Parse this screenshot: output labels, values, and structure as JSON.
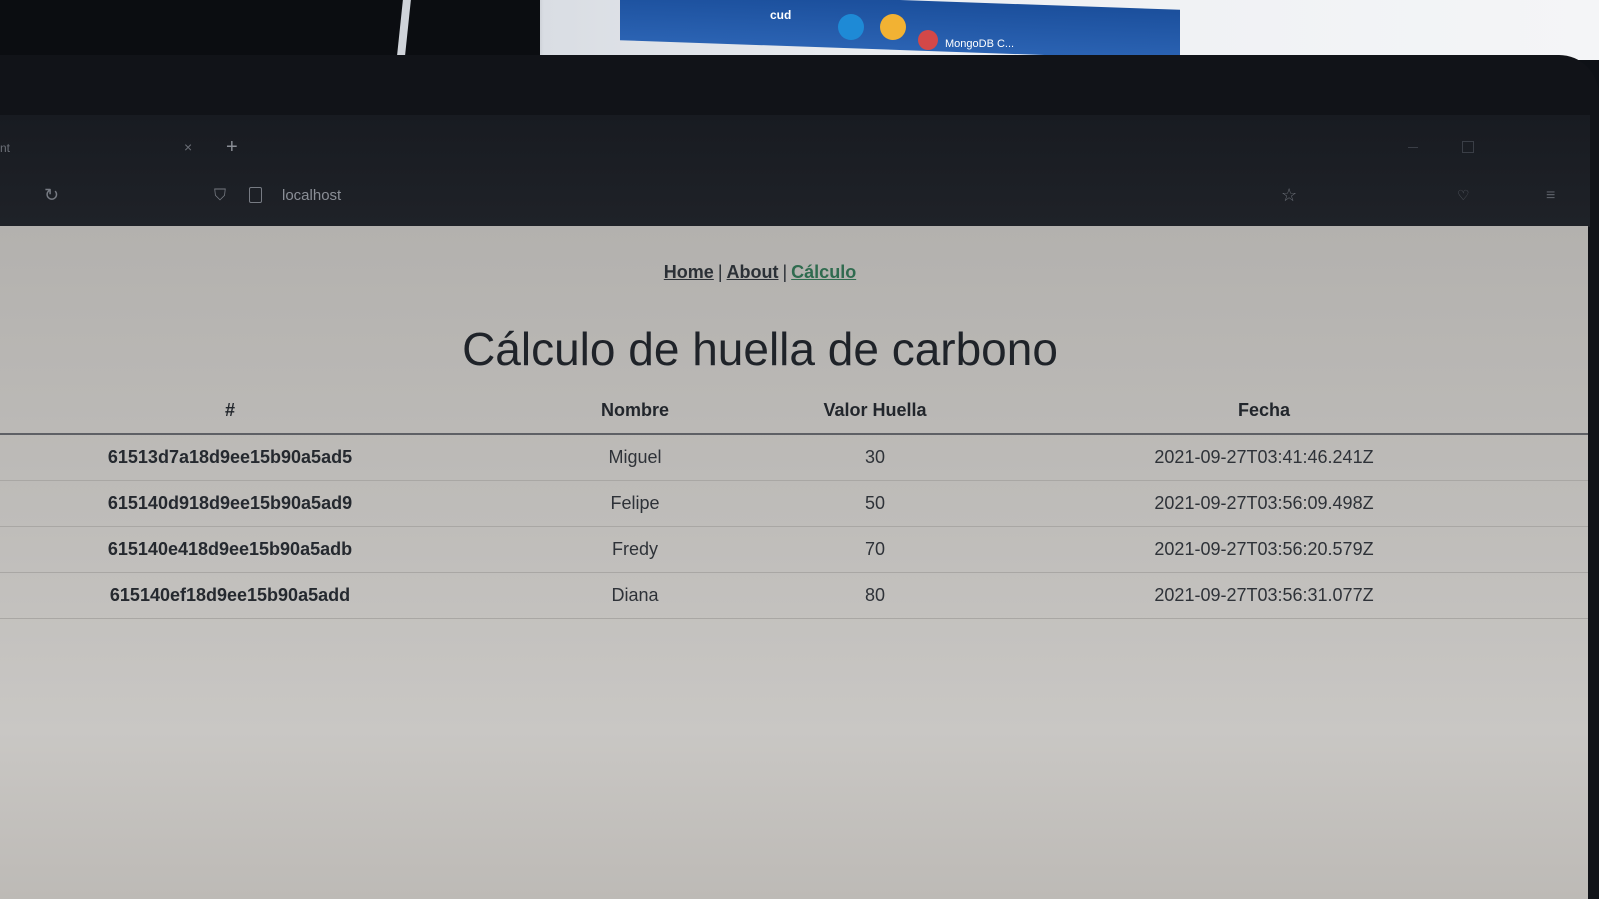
{
  "background": {
    "taskbar_label": "cud",
    "taskbar_app_label": "MongoDB C..."
  },
  "browser": {
    "tab_title_fragment": "nt",
    "tab_close": "×",
    "new_tab": "+",
    "url": "localhost",
    "icons": {
      "reload": "reload-icon",
      "shield": "shield-icon",
      "page": "page-icon",
      "star": "star-icon",
      "pocket": "pocket-icon",
      "menu": "menu-icon"
    }
  },
  "nav": {
    "home": "Home",
    "about": "About",
    "calculo": "Cálculo",
    "separator": "|"
  },
  "page_title": "Cálculo de huella de carbono",
  "table": {
    "headers": [
      "#",
      "Nombre",
      "Valor Huella",
      "Fecha"
    ],
    "rows": [
      {
        "id": "61513d7a18d9ee15b90a5ad5",
        "nombre": "Miguel",
        "valor": "30",
        "fecha": "2021-09-27T03:41:46.241Z"
      },
      {
        "id": "615140d918d9ee15b90a5ad9",
        "nombre": "Felipe",
        "valor": "50",
        "fecha": "2021-09-27T03:56:09.498Z"
      },
      {
        "id": "615140e418d9ee15b90a5adb",
        "nombre": "Fredy",
        "valor": "70",
        "fecha": "2021-09-27T03:56:20.579Z"
      },
      {
        "id": "615140ef18d9ee15b90a5add",
        "nombre": "Diana",
        "valor": "80",
        "fecha": "2021-09-27T03:56:31.077Z"
      }
    ]
  },
  "colors": {
    "page_background": "#bfbdba",
    "link": "#2b3036",
    "active_link": "#2f6b4f",
    "chrome": "#1c1f25"
  }
}
